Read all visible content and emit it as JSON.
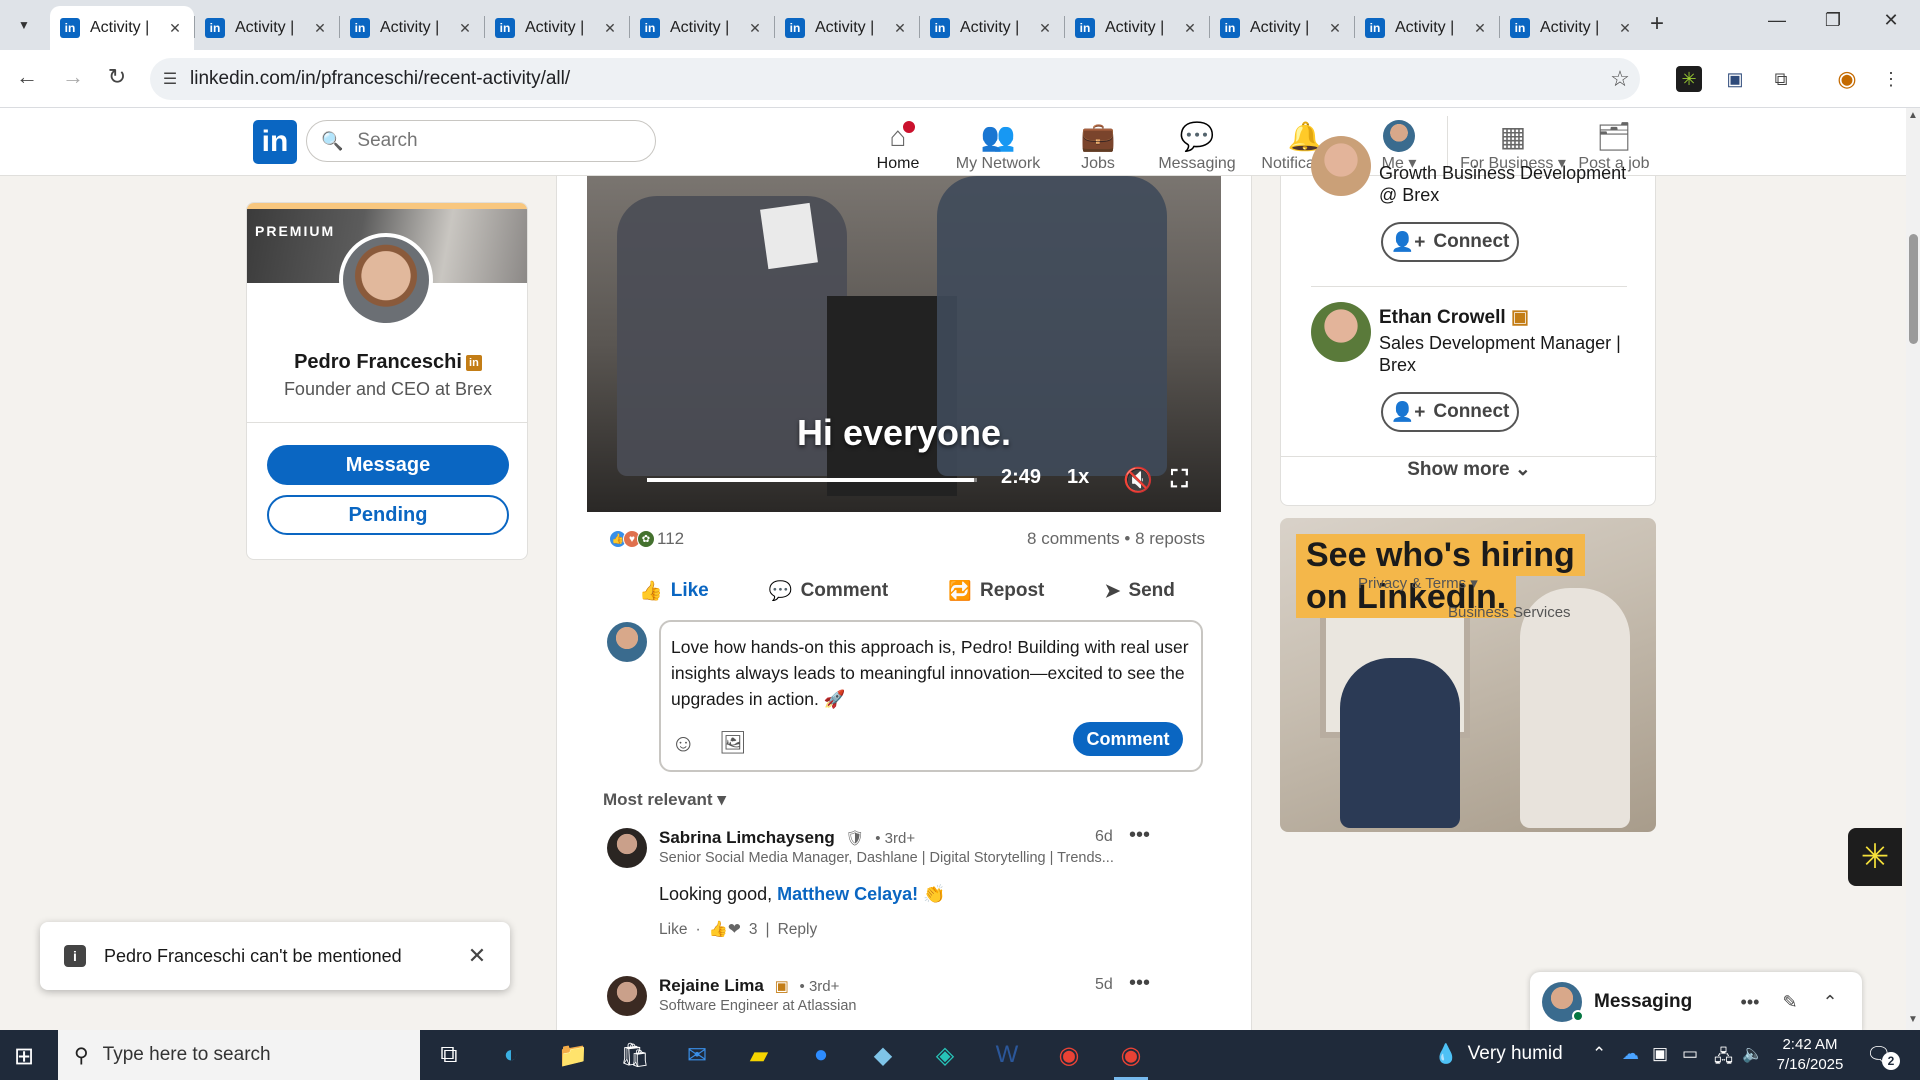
{
  "browser": {
    "tabs": [
      {
        "title": "Activity |"
      },
      {
        "title": "Activity |"
      },
      {
        "title": "Activity |"
      },
      {
        "title": "Activity |"
      },
      {
        "title": "Activity |"
      },
      {
        "title": "Activity |"
      },
      {
        "title": "Activity |"
      },
      {
        "title": "Activity |"
      },
      {
        "title": "Activity |"
      },
      {
        "title": "Activity |"
      },
      {
        "title": "Activity |"
      }
    ],
    "url": "linkedin.com/in/pfranceschi/recent-activity/all/"
  },
  "header": {
    "search_placeholder": "Search",
    "nav": {
      "home": "Home",
      "network": "My Network",
      "jobs": "Jobs",
      "messaging": "Messaging",
      "notifications": "Notifications",
      "me": "Me",
      "business": "For Business",
      "post_job": "Post a job"
    }
  },
  "profile": {
    "banner_label": "PREMIUM",
    "name": "Pedro Franceschi",
    "headline": "Founder and CEO at Brex",
    "message_label": "Message",
    "pending_label": "Pending"
  },
  "post": {
    "video": {
      "caption": "Hi everyone.",
      "time": "2:49",
      "speed": "1x",
      "progress": 0.99
    },
    "reactions_count": "112",
    "comments_count": "8 comments",
    "reposts_count": "8 reposts",
    "actions": {
      "like": "Like",
      "comment": "Comment",
      "repost": "Repost",
      "send": "Send"
    },
    "draft_comment": "Love how hands-on this approach is, Pedro! Building with real user insights always leads to meaningful innovation—excited to see the upgrades in action. 🚀",
    "comment_button": "Comment",
    "sort_label": "Most relevant"
  },
  "comments": [
    {
      "name": "Sabrina Limchayseng",
      "degree": "• 3rd+",
      "headline": "Senior Social Media Manager, Dashlane | Digital Storytelling | Trends...",
      "time": "6d",
      "text_before": "Looking good,",
      "mention": "Matthew Celaya!",
      "text_after": "👏",
      "like_label": "Like",
      "reaction_count": "3",
      "reply_label": "Reply"
    },
    {
      "name": "Rejaine Lima",
      "degree": "• 3rd+",
      "headline": "Software Engineer at Atlassian",
      "time": "5d"
    }
  ],
  "rail": {
    "person1_sub": "Growth Business Development @ Brex",
    "connect_label": "Connect",
    "person2_name": "Ethan Crowell",
    "person2_sub": "Sales Development Manager | Brex",
    "show_more": "Show more"
  },
  "ad": {
    "line1": "See who's hiring",
    "line2": "on LinkedIn.",
    "overlay1": "Privacy & Terms",
    "overlay2": "Business Services"
  },
  "messaging": {
    "label": "Messaging"
  },
  "toast": {
    "text": "Pedro Franceschi can't be mentioned"
  },
  "taskbar": {
    "search_placeholder": "Type here to search",
    "weather": "Very humid",
    "time": "2:42 AM",
    "date": "7/16/2025",
    "notification_count": "2"
  },
  "colors": {
    "linkedin_blue": "#0a66c2",
    "premium_gold": "#f8c77e",
    "notification_red": "#cb112d",
    "ad_yellow": "#f4b74a"
  }
}
